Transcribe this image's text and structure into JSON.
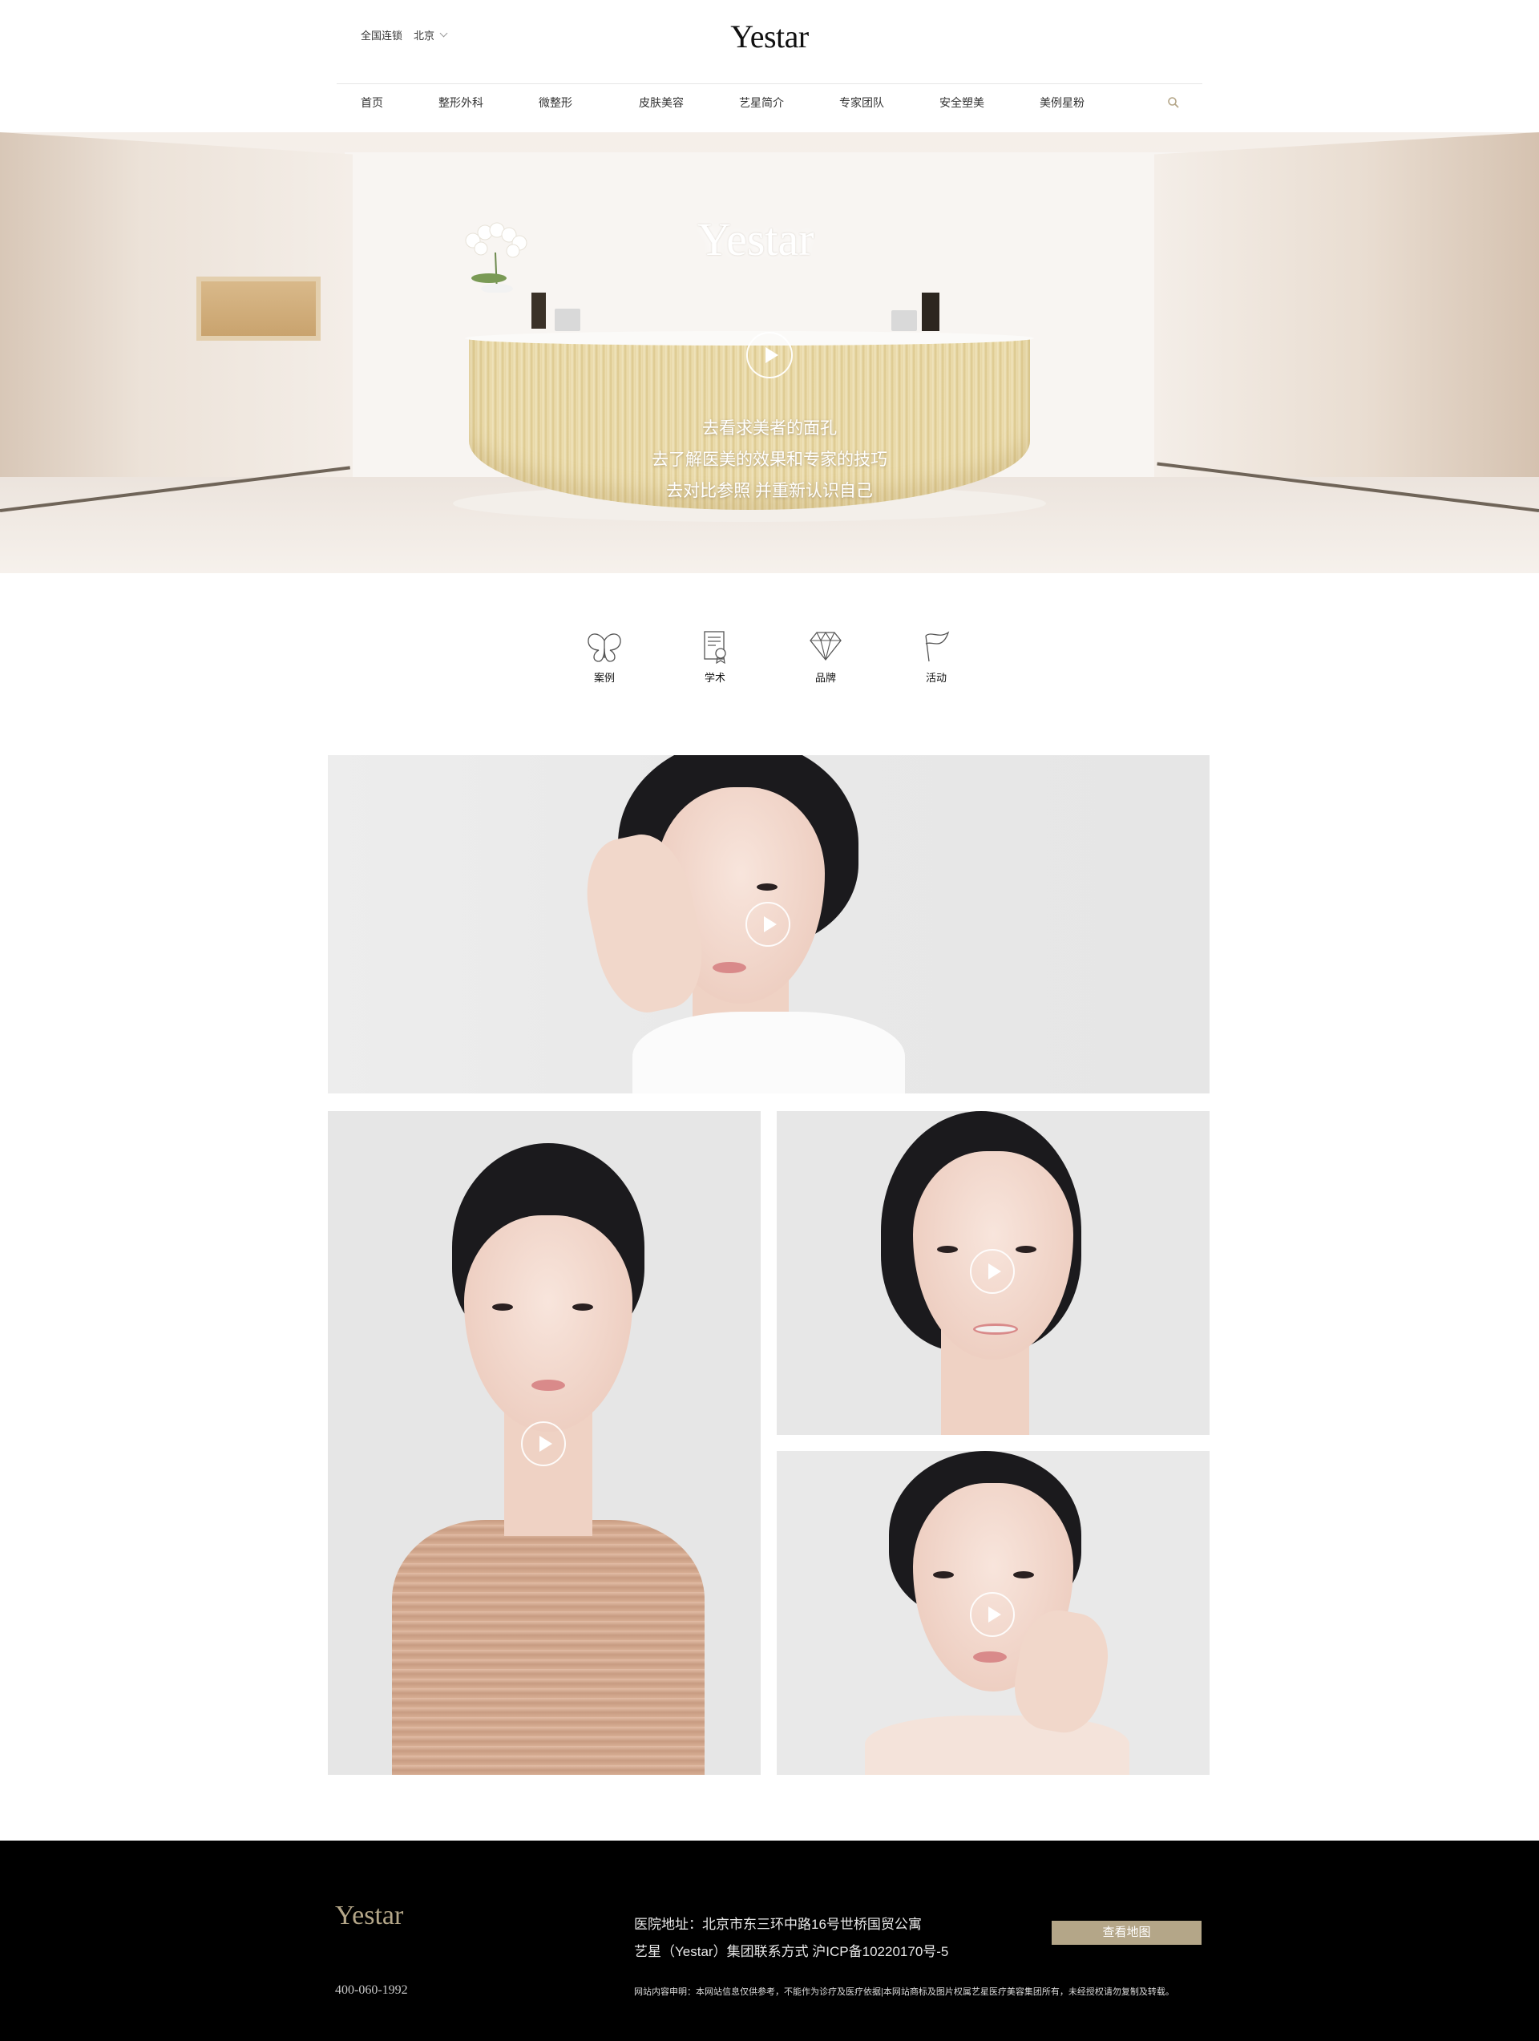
{
  "header": {
    "region_label": "全国连锁",
    "city": "北京",
    "logo": "Yestar",
    "nav": [
      "首页",
      "整形外科",
      "微整形",
      "皮肤美容",
      "艺星简介",
      "专家团队",
      "安全塑美",
      "美例星粉"
    ]
  },
  "hero": {
    "wall_logo": "Yestar",
    "lines": [
      "去看求美者的面孔",
      "去了解医美的效果和专家的技巧",
      "去对比参照 并重新认识自己"
    ]
  },
  "categories": [
    {
      "label": "案例",
      "icon": "butterfly-icon"
    },
    {
      "label": "学术",
      "icon": "certificate-icon"
    },
    {
      "label": "品牌",
      "icon": "diamond-icon"
    },
    {
      "label": "活动",
      "icon": "flag-icon"
    }
  ],
  "footer": {
    "logo": "Yestar",
    "phone": "400-060-1992",
    "address": "医院地址：北京市东三环中路16号世桥国贸公寓",
    "contact": "艺星（Yestar）集团联系方式 沪ICP备10220170号-5",
    "map_button": "查看地图",
    "disclaimer": "网站内容申明：本网站信息仅供参考，不能作为诊疗及医疗依据|本网站商标及图片权属艺星医疗美容集团所有，未经授权请勿复制及转载。"
  },
  "colors": {
    "accent_gold": "#b4a688",
    "footer_bg": "#000000"
  }
}
